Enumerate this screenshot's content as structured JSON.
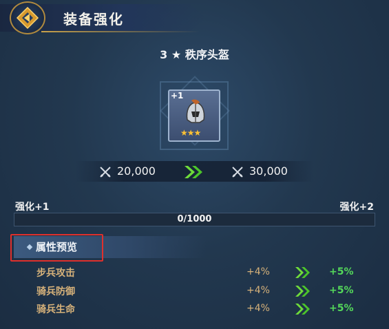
{
  "header": {
    "title": "装备强化",
    "back_icon": "diamond-back-icon"
  },
  "item": {
    "star_count": "3",
    "star_glyph": "★",
    "name": "秩序头盔",
    "level_badge": "+1",
    "rarity_stars": "★★★",
    "icon": "helmet-icon"
  },
  "power": {
    "current": "20,000",
    "next": "30,000",
    "icon": "crossed-swords-icon",
    "arrow_icon": "double-chevron-right-icon"
  },
  "progress": {
    "from_label": "强化+1",
    "to_label": "强化+2",
    "text": "0/1000",
    "fraction": 0
  },
  "preview": {
    "title": "属性预览"
  },
  "stats": [
    {
      "name": "步兵攻击",
      "current": "+4%",
      "next": "+5%"
    },
    {
      "name": "骑兵防御",
      "current": "+4%",
      "next": "+5%"
    },
    {
      "name": "骑兵生命",
      "current": "+4%",
      "next": "+5%"
    }
  ],
  "colors": {
    "accent_gold": "#d7b27a",
    "increase_green": "#54d85a",
    "highlight_red": "#e0302c",
    "star_gold": "#ffc233"
  }
}
